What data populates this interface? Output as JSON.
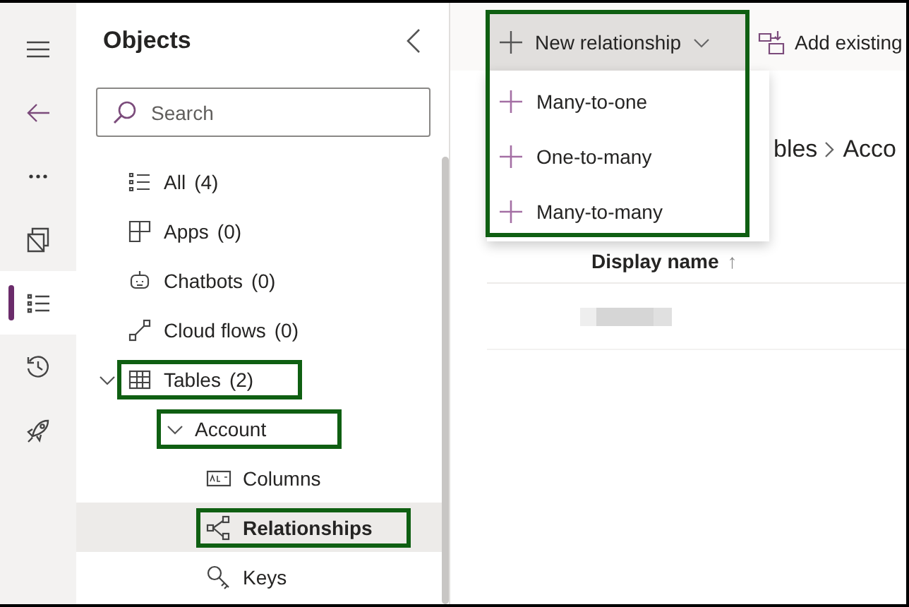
{
  "rail": [
    {
      "selected": false
    },
    {
      "selected": false
    },
    {
      "selected": false
    },
    {
      "selected": false
    },
    {
      "selected": true
    },
    {
      "selected": false
    },
    {
      "selected": false
    }
  ],
  "objects_panel": {
    "title": "Objects",
    "search": {
      "placeholder": "Search"
    },
    "tree": [
      {
        "label": "All",
        "count": "(4)",
        "selected": false,
        "highlighted": false
      },
      {
        "label": "Apps",
        "count": "(0)",
        "selected": false,
        "highlighted": false
      },
      {
        "label": "Chatbots",
        "count": "(0)",
        "selected": false,
        "highlighted": false
      },
      {
        "label": "Cloud flows",
        "count": "(0)",
        "selected": false,
        "highlighted": false
      },
      {
        "label": "Tables",
        "count": "(2)",
        "selected": false,
        "highlighted": true,
        "expanded": true,
        "children": [
          {
            "label": "Account",
            "selected": false,
            "highlighted": true,
            "expanded": true,
            "children": [
              {
                "label": "Columns",
                "selected": false,
                "highlighted": false
              },
              {
                "label": "Relationships",
                "selected": true,
                "highlighted": true
              },
              {
                "label": "Keys",
                "selected": false,
                "highlighted": false
              }
            ]
          }
        ]
      }
    ]
  },
  "toolbar": {
    "new_relationship": {
      "label": "New relationship",
      "expanded": true,
      "highlighted": true,
      "menu": [
        "Many-to-one",
        "One-to-many",
        "Many-to-many"
      ]
    },
    "add_existing": {
      "label": "Add existing"
    }
  },
  "breadcrumb": [
    "bles",
    "Acco"
  ],
  "table": {
    "columns": [
      {
        "label": "Display name",
        "sort": "↑"
      }
    ]
  }
}
